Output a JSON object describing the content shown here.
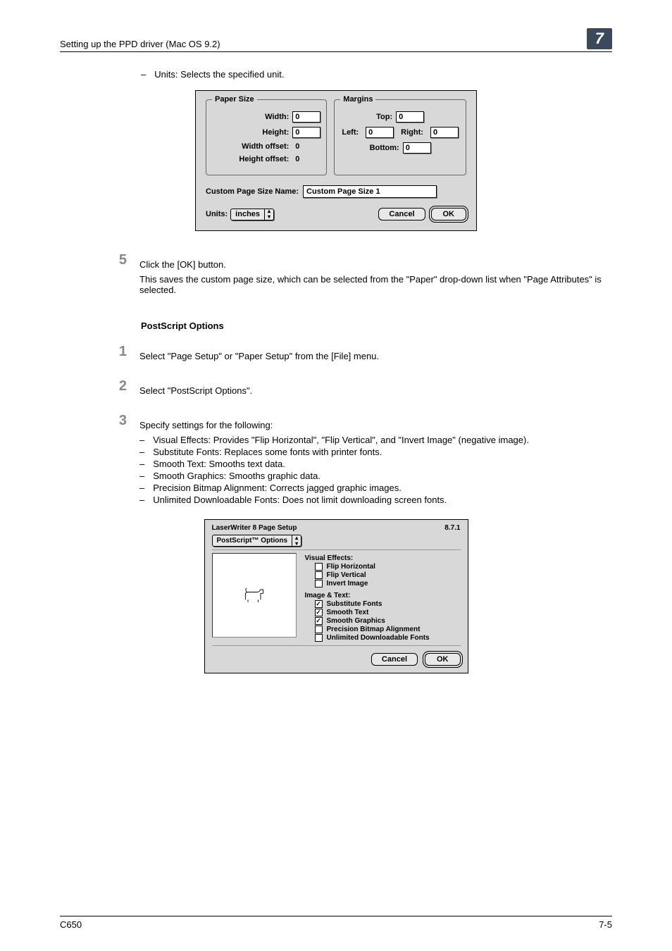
{
  "header": {
    "title": "Setting up the PPD driver (Mac OS 9.2)",
    "chapter": "7"
  },
  "intro_bullet": "Units: Selects the specified unit.",
  "dialog1": {
    "paper_size": {
      "legend": "Paper Size",
      "width_label": "Width:",
      "width_value": "0",
      "height_label": "Height:",
      "height_value": "0",
      "width_offset_label": "Width offset:",
      "width_offset_value": "0",
      "height_offset_label": "Height offset:",
      "height_offset_value": "0"
    },
    "margins": {
      "legend": "Margins",
      "top_label": "Top:",
      "top_value": "0",
      "left_label": "Left:",
      "left_value": "0",
      "right_label": "Right:",
      "right_value": "0",
      "bottom_label": "Bottom:",
      "bottom_value": "0"
    },
    "name_label": "Custom Page Size Name:",
    "name_value": "Custom Page Size 1",
    "units_label": "Units:",
    "units_value": "inches",
    "cancel": "Cancel",
    "ok": "OK"
  },
  "step5": {
    "num": "5",
    "line1": "Click the [OK] button.",
    "line2": "This saves the custom page size, which can be selected from the \"Paper\" drop-down list when \"Page Attributes\" is selected."
  },
  "section_heading": "PostScript Options",
  "step1": {
    "num": "1",
    "text": "Select \"Page Setup\" or \"Paper Setup\" from the [File] menu."
  },
  "step2": {
    "num": "2",
    "text": "Select \"PostScript Options\"."
  },
  "step3": {
    "num": "3",
    "lead": "Specify settings for the following:",
    "bullets": [
      "Visual Effects: Provides \"Flip Horizontal\", \"Flip Vertical\", and \"Invert Image\" (negative image).",
      "Substitute Fonts: Replaces some fonts with printer fonts.",
      "Smooth Text: Smooths text data.",
      "Smooth Graphics: Smooths graphic data.",
      "Precision Bitmap Alignment: Corrects jagged graphic images.",
      "Unlimited Downloadable Fonts: Does not limit downloading screen fonts."
    ]
  },
  "dialog2": {
    "title": "LaserWriter 8 Page Setup",
    "version": "8.7.1",
    "dropdown": "PostScript™ Options",
    "visual_effects_label": "Visual Effects:",
    "flip_h": "Flip Horizontal",
    "flip_v": "Flip Vertical",
    "invert": "Invert Image",
    "image_text_label": "Image & Text:",
    "sub_fonts": "Substitute Fonts",
    "smooth_text": "Smooth Text",
    "smooth_graphics": "Smooth Graphics",
    "precision": "Precision Bitmap Alignment",
    "unlimited": "Unlimited Downloadable Fonts",
    "cancel": "Cancel",
    "ok": "OK"
  },
  "footer": {
    "left": "C650",
    "right": "7-5"
  },
  "checks": {
    "on": "✓",
    "off": ""
  }
}
